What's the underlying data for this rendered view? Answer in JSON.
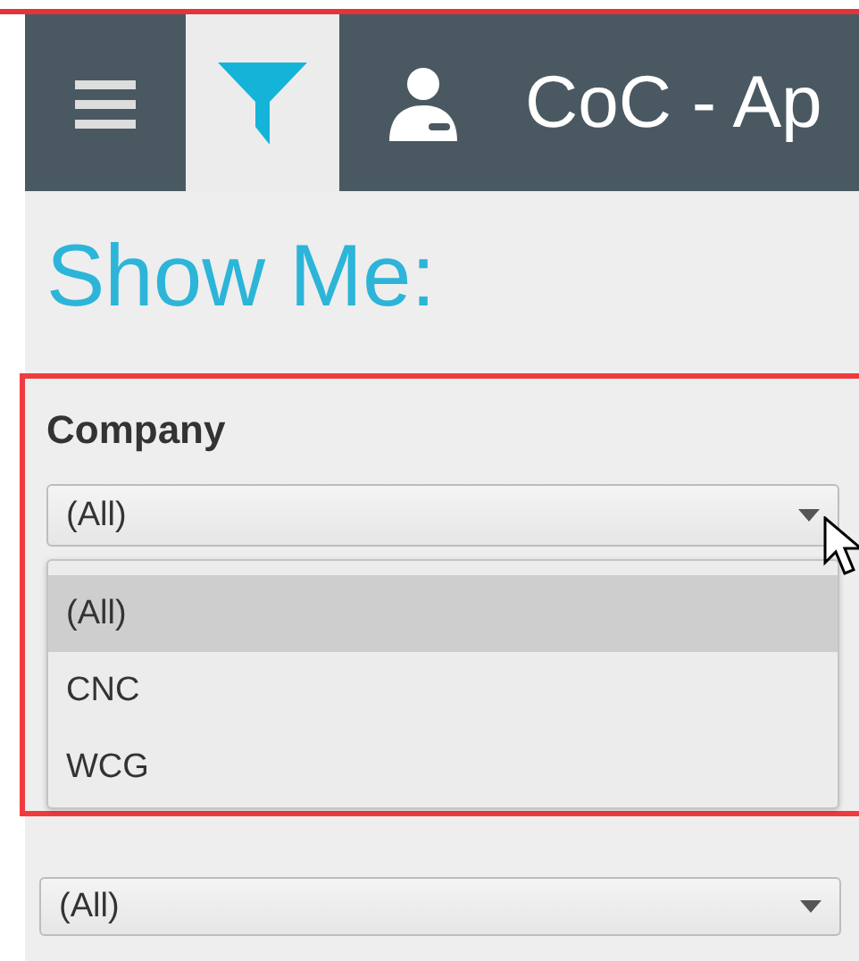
{
  "header": {
    "title": "CoC - Ap",
    "filter_tab_selected": true
  },
  "heading": "Show Me:",
  "company_filter": {
    "label": "Company",
    "value": "(All)",
    "open": true,
    "options": [
      {
        "label": "(All)",
        "selected": true
      },
      {
        "label": "CNC",
        "selected": false
      },
      {
        "label": "WCG",
        "selected": false
      }
    ]
  },
  "lower_filter": {
    "value": "(All)"
  }
}
